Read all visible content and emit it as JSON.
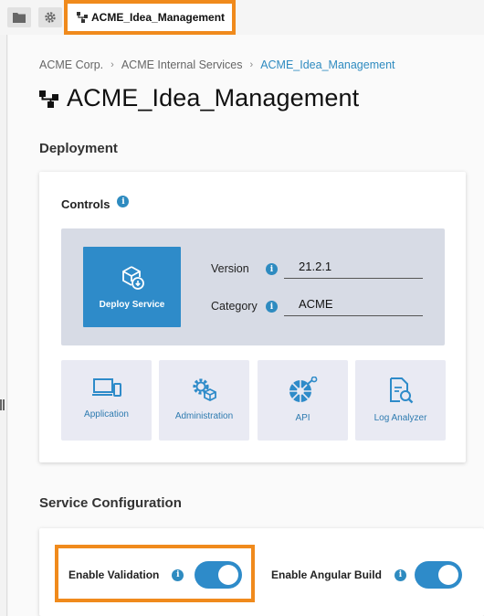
{
  "tabs": {
    "folder_icon": "folder-icon",
    "settings_icon": "gear-icon",
    "active_label": "ACME_Idea_Management",
    "active_icon": "service-tree-icon"
  },
  "breadcrumb": [
    "ACME Corp.",
    "ACME Internal Services",
    "ACME_Idea_Management"
  ],
  "page_title": "ACME_Idea_Management",
  "deployment": {
    "section_title": "Deployment",
    "controls_title": "Controls",
    "deploy_button": "Deploy Service",
    "version_label": "Version",
    "version_value": "21.2.1",
    "category_label": "Category",
    "category_value": "ACME",
    "tiles": [
      {
        "label": "Application",
        "icon": "devices-icon"
      },
      {
        "label": "Administration",
        "icon": "admin-gear-icon"
      },
      {
        "label": "API",
        "icon": "api-icon"
      },
      {
        "label": "Log Analyzer",
        "icon": "log-analyzer-icon"
      }
    ]
  },
  "service_config": {
    "section_title": "Service Configuration",
    "toggles": [
      {
        "label": "Enable Validation",
        "on": true
      },
      {
        "label": "Enable Angular Build",
        "on": true
      }
    ]
  },
  "colors": {
    "accent": "#2e8bc9",
    "highlight": "#f08a1c"
  }
}
